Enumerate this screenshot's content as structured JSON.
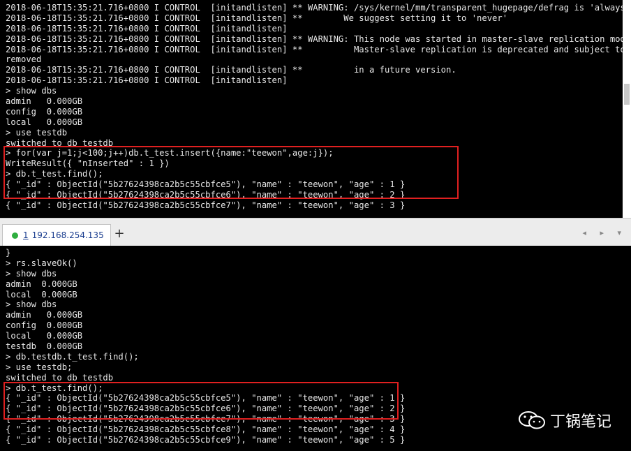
{
  "top_terminal": {
    "lines": [
      "2018-06-18T15:35:21.716+0800 I CONTROL  [initandlisten] ** WARNING: /sys/kernel/mm/transparent_hugepage/defrag is 'always'.",
      "2018-06-18T15:35:21.716+0800 I CONTROL  [initandlisten] **        We suggest setting it to 'never'",
      "2018-06-18T15:35:21.716+0800 I CONTROL  [initandlisten]",
      "2018-06-18T15:35:21.716+0800 I CONTROL  [initandlisten] ** WARNING: This node was started in master-slave replication mode.",
      "2018-06-18T15:35:21.716+0800 I CONTROL  [initandlisten] **          Master-slave replication is deprecated and subject to be",
      "removed",
      "2018-06-18T15:35:21.716+0800 I CONTROL  [initandlisten] **          in a future version.",
      "2018-06-18T15:35:21.716+0800 I CONTROL  [initandlisten]",
      "> show dbs",
      "admin   0.000GB",
      "config  0.000GB",
      "local   0.000GB",
      "> use testdb",
      "switched to db testdb",
      "> for(var j=1;j<100;j++)db.t_test.insert({name:\"teewon\",age:j});",
      "WriteResult({ \"nInserted\" : 1 })",
      "> db.t_test.find();",
      "{ \"_id\" : ObjectId(\"5b27624398ca2b5c55cbfce5\"), \"name\" : \"teewon\", \"age\" : 1 }",
      "{ \"_id\" : ObjectId(\"5b27624398ca2b5c55cbfce6\"), \"name\" : \"teewon\", \"age\" : 2 }",
      "{ \"_id\" : ObjectId(\"5b27624398ca2b5c55cbfce7\"), \"name\" : \"teewon\", \"age\" : 3 }"
    ]
  },
  "tabbar": {
    "tab_number": "1",
    "tab_label": "192.168.254.135",
    "add_label": "+",
    "nav_arrows": "◂ ▸ ▾"
  },
  "bottom_terminal": {
    "lines": [
      "}",
      "> rs.slaveOk()",
      "> show dbs",
      "admin  0.000GB",
      "local  0.000GB",
      "> show dbs",
      "admin   0.000GB",
      "config  0.000GB",
      "local   0.000GB",
      "testdb  0.000GB",
      "> db.testdb.t_test.find();",
      "> use testdb;",
      "switched to db testdb",
      "> db.t_test.find();",
      "{ \"_id\" : ObjectId(\"5b27624398ca2b5c55cbfce5\"), \"name\" : \"teewon\", \"age\" : 1 }",
      "{ \"_id\" : ObjectId(\"5b27624398ca2b5c55cbfce6\"), \"name\" : \"teewon\", \"age\" : 2 }",
      "{ \"_id\" : ObjectId(\"5b27624398ca2b5c55cbfce7\"), \"name\" : \"teewon\", \"age\" : 3 }",
      "{ \"_id\" : ObjectId(\"5b27624398ca2b5c55cbfce8\"), \"name\" : \"teewon\", \"age\" : 4 }",
      "{ \"_id\" : ObjectId(\"5b27624398ca2b5c55cbfce9\"), \"name\" : \"teewon\", \"age\" : 5 }"
    ]
  },
  "watermark": {
    "text": "丁锅笔记",
    "icon": "wechat-icon"
  },
  "colors": {
    "highlight_box": "#e02020",
    "terminal_bg": "#000000",
    "terminal_fg": "#e8e8e8",
    "session_dot": "#2fae3f"
  }
}
